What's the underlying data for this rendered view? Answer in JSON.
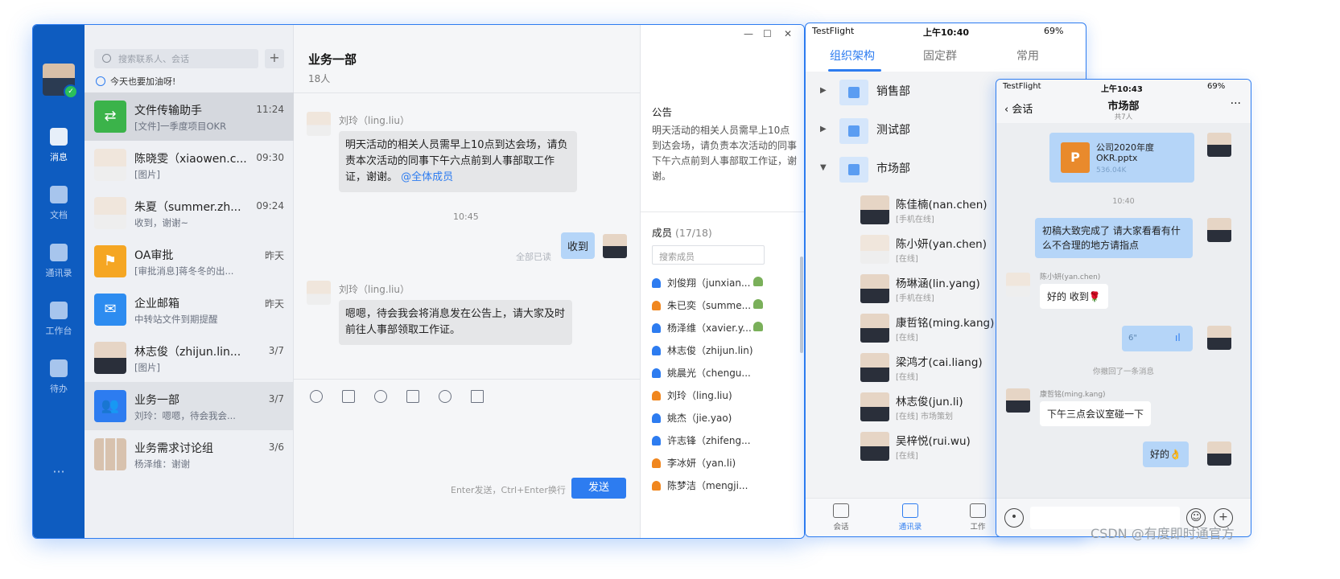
{
  "desktop": {
    "window_controls": [
      "—",
      "☐",
      "✕"
    ],
    "search_placeholder": "搜索联系人、会话",
    "add_label": "+",
    "motto": "今天也要加油呀!",
    "rail": [
      {
        "label": "消息",
        "icon": "message-icon",
        "active": true
      },
      {
        "label": "文档",
        "icon": "document-icon"
      },
      {
        "label": "通讯录",
        "icon": "contacts-icon"
      },
      {
        "label": "工作台",
        "icon": "workbench-icon"
      },
      {
        "label": "待办",
        "icon": "todo-icon"
      },
      {
        "label": "···",
        "icon": "more-icon"
      }
    ],
    "conversations": [
      {
        "name": "文件传输助手",
        "time": "11:24",
        "preview": "[文件]一季度项目OKR",
        "avatar_color": "#3bb34a"
      },
      {
        "name": "陈晓雯（xiaowen.c...",
        "time": "09:30",
        "preview": "[图片]"
      },
      {
        "name": "朱夏（summer.zh...",
        "time": "09:24",
        "preview": "收到，谢谢~"
      },
      {
        "name": "OA审批",
        "time": "昨天",
        "preview": "[审批消息]蒋冬冬的出...",
        "avatar_color": "#f5a623"
      },
      {
        "name": "企业邮箱",
        "time": "昨天",
        "preview": "中转站文件到期提醒",
        "avatar_color": "#2d8cf0"
      },
      {
        "name": "林志俊（zhijun.lin...",
        "time": "3/7",
        "preview": "[图片]"
      },
      {
        "name": "业务一部",
        "time": "3/7",
        "preview": "刘玲：嗯嗯，待会我会...",
        "avatar_color": "#2d7cf0"
      },
      {
        "name": "业务需求讨论组",
        "time": "3/6",
        "preview": "杨泽维：谢谢"
      }
    ],
    "chat": {
      "title": "业务一部",
      "subtitle": "18人",
      "messages": [
        {
          "sender": "刘玲（ling.liu）",
          "text": "明天活动的相关人员需早上10点到达会场，请负责本次活动的同事下午六点前到人事部取工作证，谢谢。",
          "mention": "@全体成员"
        },
        {
          "time": "10:45"
        },
        {
          "me": true,
          "text": "收到",
          "status": "全部已读"
        },
        {
          "sender": "刘玲（ling.liu）",
          "text": "嗯嗯，待会我会将消息发在公告上，请大家及时前往人事部领取工作证。"
        }
      ],
      "hint": "Enter发送，Ctrl+Enter换行",
      "send_label": "发送"
    },
    "sidebar": {
      "announcement_title": "公告",
      "announcement_body": "明天活动的相关人员需早上10点到达会场，请负责本次活动的同事下午六点前到人事部取工作证，谢谢。",
      "members_title": "成员",
      "members_count": "(17/18)",
      "member_search": "搜索成员",
      "members": [
        {
          "name": "刘俊翔（junxian...",
          "color": "#2d7cf0",
          "badge": true
        },
        {
          "name": "朱已奕（summe...",
          "color": "#f0861e",
          "badge": true
        },
        {
          "name": "杨泽维（xavier.y...",
          "color": "#2d7cf0",
          "badge": true
        },
        {
          "name": "林志俊（zhijun.lin)",
          "color": "#2d7cf0"
        },
        {
          "name": "姚晨光（chengu...",
          "color": "#2d7cf0"
        },
        {
          "name": "刘玲（ling.liu)",
          "color": "#f0861e"
        },
        {
          "name": "姚杰（jie.yao)",
          "color": "#2d7cf0"
        },
        {
          "name": "许志锋（zhifeng...",
          "color": "#2d7cf0"
        },
        {
          "name": "李冰妍（yan.li)",
          "color": "#f0861e"
        },
        {
          "name": "陈梦洁（mengji...",
          "color": "#f0861e"
        }
      ]
    }
  },
  "phone1": {
    "status": {
      "app": "TestFlight",
      "time": "上午10:40",
      "battery": "69%"
    },
    "tabs": [
      "组织架构",
      "固定群",
      "常用"
    ],
    "departments": [
      {
        "name": "销售部",
        "expanded": false
      },
      {
        "name": "测试部",
        "expanded": false
      },
      {
        "name": "市场部",
        "expanded": true
      }
    ],
    "people": [
      {
        "name": "陈佳楠(nan.chen)",
        "status": "[手机在线]"
      },
      {
        "name": "陈小妍(yan.chen)",
        "status": "[在线]"
      },
      {
        "name": "杨琳涵(lin.yang)",
        "status": "[手机在线]"
      },
      {
        "name": "康哲铭(ming.kang)",
        "status": "[在线]"
      },
      {
        "name": "梁鸿才(cai.liang)",
        "status": "[在线]"
      },
      {
        "name": "林志俊(jun.li)",
        "status": "[在线] 市场策划"
      },
      {
        "name": "吴梓悦(rui.wu)",
        "status": "[在线]"
      }
    ],
    "nav": [
      {
        "label": "会话"
      },
      {
        "label": "通讯录",
        "active": true
      },
      {
        "label": "工作"
      }
    ]
  },
  "phone2": {
    "status": {
      "app": "TestFlight",
      "time": "上午10:43",
      "battery": "69%"
    },
    "back_label": "会话",
    "title": "市场部",
    "subtitle": "共7人",
    "more": "···",
    "file": {
      "name": "公司2020年度OKR.pptx",
      "size": "536.04K",
      "icon": "P"
    },
    "time_center": "10:40",
    "msg_me_1": "初稿大致完成了 请大家看看有什么不合理的地方请指点",
    "other_1": {
      "name": "陈小妍(yan.chen)",
      "text": "好的 收到🌹"
    },
    "voice": {
      "duration": "6\"",
      "icon": "voice-wave-icon"
    },
    "recall": "你撤回了一条消息",
    "other_2": {
      "name": "康哲铭(ming.kang)",
      "text": "下午三点会议室碰一下"
    },
    "msg_me_2": "好的👌"
  },
  "watermark": "CSDN @有度即时通官方"
}
